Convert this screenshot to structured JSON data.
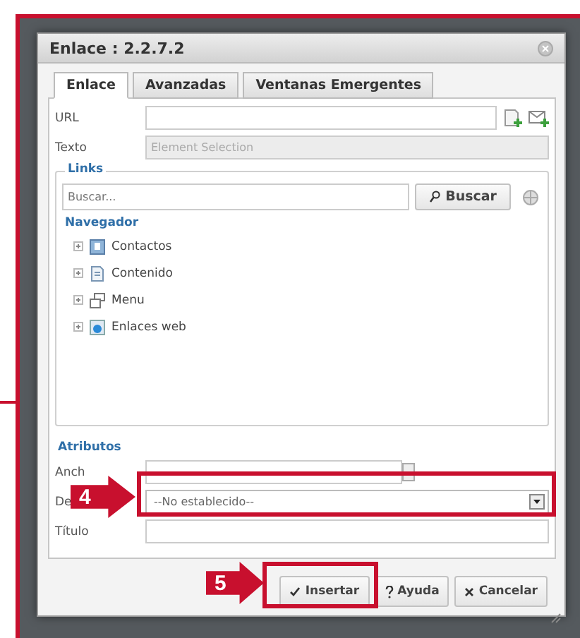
{
  "dialog": {
    "title": "Enlace : 2.2.7.2"
  },
  "tabs": [
    {
      "label": "Enlace",
      "selected": true
    },
    {
      "label": "Avanzadas",
      "selected": false
    },
    {
      "label": "Ventanas Emergentes",
      "selected": false
    }
  ],
  "url": {
    "label": "URL"
  },
  "texto": {
    "label": "Texto",
    "value": "Element Selection",
    "disabled": true
  },
  "links": {
    "legend": "Links",
    "search": {
      "placeholder": "Buscar..."
    },
    "search_button": "Buscar",
    "navigator_title": "Navegador",
    "tree": [
      {
        "label": "Contactos",
        "kind": "contacts"
      },
      {
        "label": "Contenido",
        "kind": "content"
      },
      {
        "label": "Menu",
        "kind": "menu"
      },
      {
        "label": "Enlaces web",
        "kind": "web"
      }
    ]
  },
  "attributes": {
    "legend": "Atributos",
    "fields": [
      {
        "label": "Anch",
        "kind": "number"
      },
      {
        "label": "De",
        "kind": "select",
        "value": "--No establecido--"
      },
      {
        "label": "Título",
        "kind": "text"
      }
    ]
  },
  "buttons": [
    {
      "label": "Insertar",
      "kind": "insert"
    },
    {
      "label": "Ayuda",
      "kind": "help"
    },
    {
      "label": "Cancelar",
      "kind": "cancel"
    }
  ],
  "callouts": [
    {
      "number": "4",
      "kind": "select"
    },
    {
      "number": "5",
      "kind": "insert"
    }
  ]
}
